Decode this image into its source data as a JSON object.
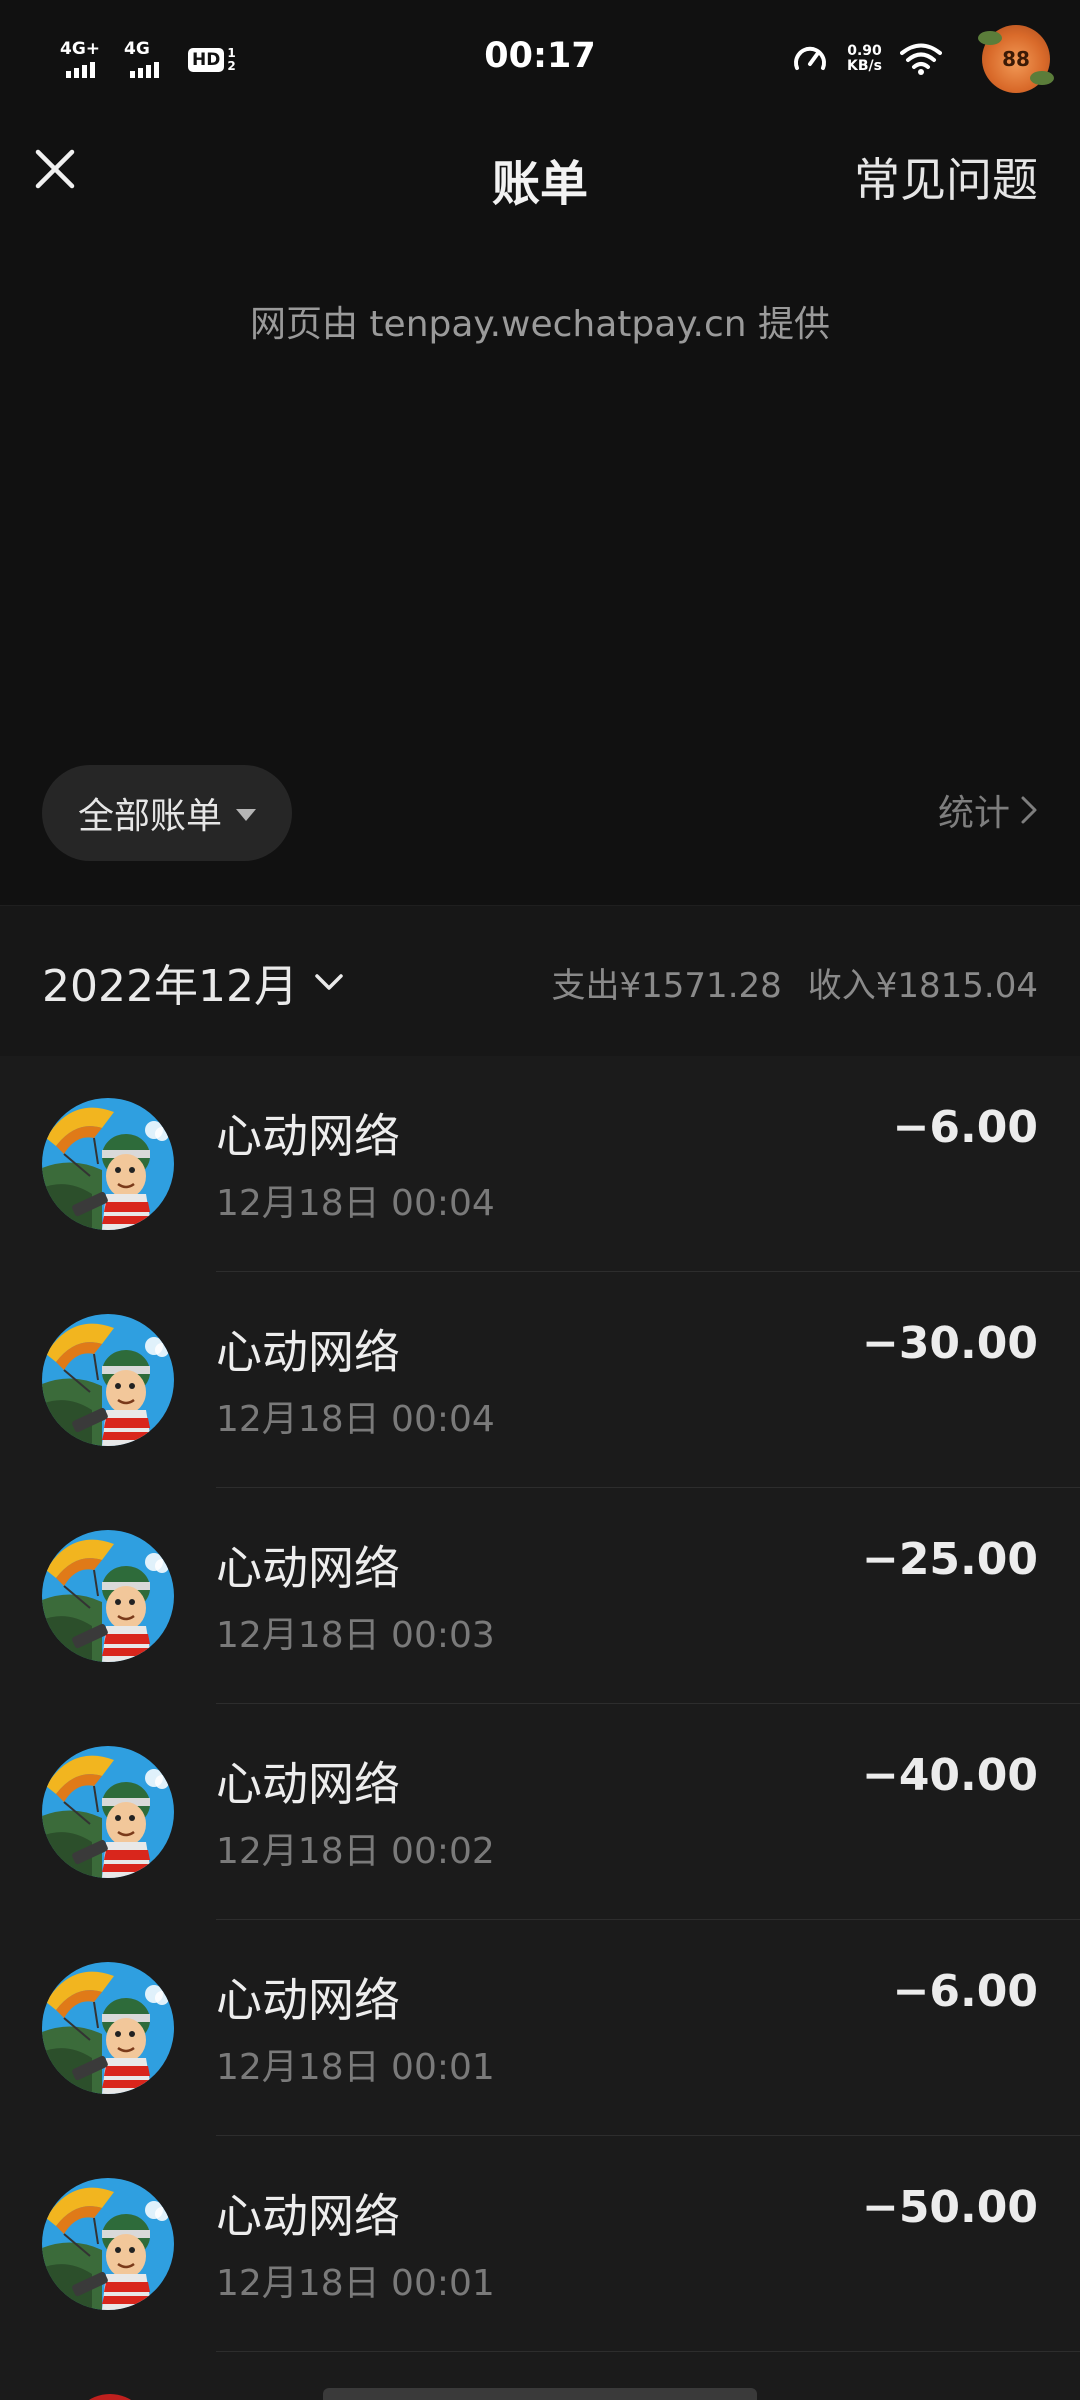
{
  "status_bar": {
    "network1": "4G+",
    "network2": "4G",
    "hd_label": "HD",
    "hd_sub1": "1",
    "hd_sub2": "2",
    "time": "00:17",
    "speed_value": "0.90",
    "speed_unit": "KB/s",
    "avatar_text": "88"
  },
  "header": {
    "title": "账单",
    "faq_label": "常见问题",
    "provider_text": "网页由 tenpay.wechatpay.cn 提供"
  },
  "filter": {
    "all_bills_label": "全部账单",
    "stats_label": "统计"
  },
  "month": {
    "label": "2022年12月",
    "expense_label": "支出¥1571.28",
    "income_label": "收入¥1815.04"
  },
  "transactions": [
    {
      "name": "心动网络",
      "time": "12月18日 00:04",
      "amount": "−6.00"
    },
    {
      "name": "心动网络",
      "time": "12月18日 00:04",
      "amount": "−30.00"
    },
    {
      "name": "心动网络",
      "time": "12月18日 00:03",
      "amount": "−25.00"
    },
    {
      "name": "心动网络",
      "time": "12月18日 00:02",
      "amount": "−40.00"
    },
    {
      "name": "心动网络",
      "time": "12月18日 00:01",
      "amount": "−6.00"
    },
    {
      "name": "心动网络",
      "time": "12月18日 00:01",
      "amount": "−50.00"
    }
  ],
  "icons": {
    "close": "close-icon",
    "dropdown": "caret-down-icon",
    "chevron_right": "chevron-right-icon",
    "chevron_down": "chevron-down-icon"
  },
  "colors": {
    "background": "#111111",
    "list_background": "#1b1b1b",
    "text_primary": "#ececec",
    "text_secondary": "#7a7a7a"
  }
}
